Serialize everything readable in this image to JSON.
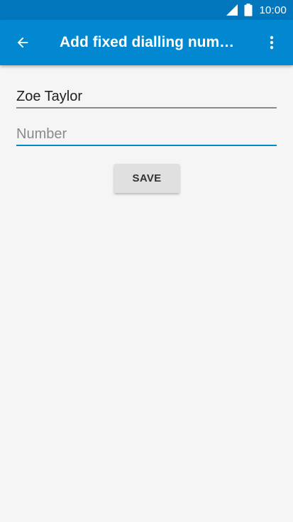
{
  "status_bar": {
    "time": "10:00",
    "icons": [
      "signal-icon",
      "battery-icon"
    ]
  },
  "app_bar": {
    "title": "Add fixed dialling number",
    "back_icon": "arrow-left-icon",
    "menu_icon": "more-vertical-icon"
  },
  "form": {
    "name_value": "Zoe Taylor",
    "number_value": "",
    "number_placeholder": "Number",
    "save_label": "SAVE"
  },
  "colors": {
    "status_bar": "#0277bd",
    "app_bar": "#0288d1",
    "background": "#f5f5f5",
    "focused_underline": "#0288d1",
    "button": "#e0e0e0"
  }
}
